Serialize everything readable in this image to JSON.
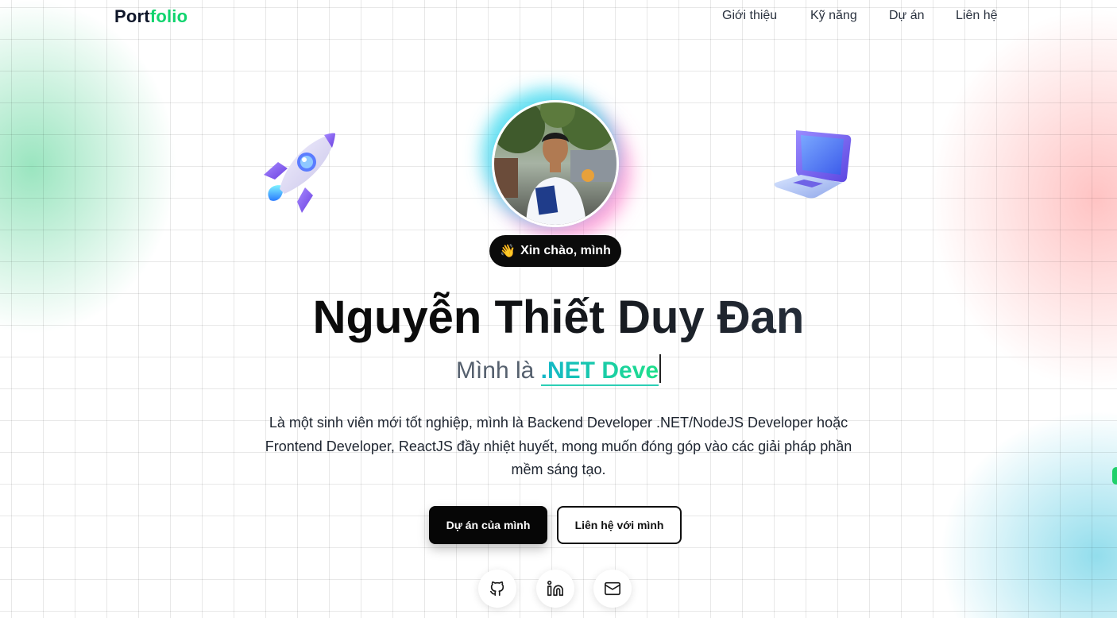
{
  "nav": {
    "logo_part1": "Port",
    "logo_part2": "folio",
    "links": [
      "Giới thiệu",
      "Kỹ năng",
      "Dự án",
      "Liên hệ"
    ]
  },
  "hero": {
    "greeting_emoji": "👋",
    "greeting": "Xin chào, mình",
    "name": "Nguyễn Thiết Duy Đan",
    "role_prefix": "Mình là",
    "role_typed": ".NET Deve",
    "description": "Là một sinh viên mới tốt nghiệp, mình là Backend Developer .NET/NodeJS Developer hoặc Frontend Developer, ReactJS đầy nhiệt huyết, mong muốn đóng góp vào các giải pháp phần mềm sáng tạo.",
    "primary_button": "Dự án của mình",
    "secondary_button": "Liên hệ với mình"
  },
  "social": [
    "github-icon",
    "linkedin-icon",
    "mail-icon"
  ],
  "decor": [
    "rocket-icon",
    "laptop-icon"
  ],
  "colors": {
    "brand_green": "#10d46e",
    "accent_teal": "#17c3a3",
    "dark": "#060606"
  }
}
